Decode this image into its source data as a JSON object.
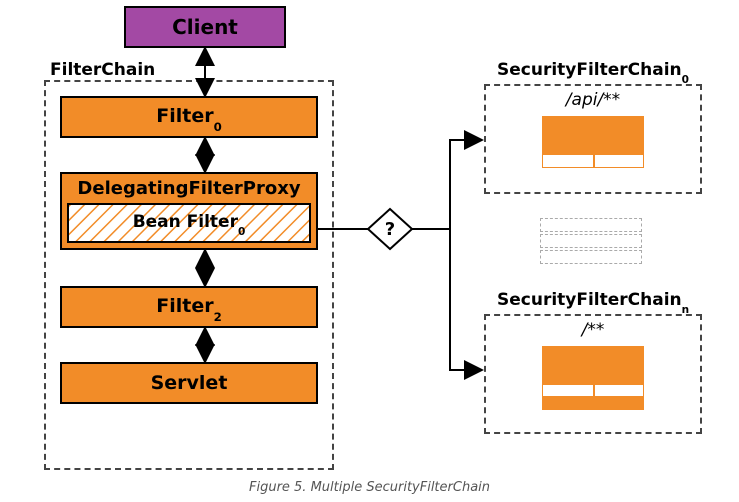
{
  "client": {
    "label": "Client"
  },
  "filterchain": {
    "label": "FilterChain"
  },
  "filter0": {
    "label": "Filter",
    "sub": "0"
  },
  "delegating": {
    "label": "DelegatingFilterProxy"
  },
  "bean": {
    "label": "Bean Filter",
    "sub": "0"
  },
  "filter2": {
    "label": "Filter",
    "sub": "2"
  },
  "servlet": {
    "label": "Servlet"
  },
  "decision": {
    "label": "?"
  },
  "sfc0": {
    "label": "SecurityFilterChain",
    "sub": "0",
    "pattern": "/api/**"
  },
  "sfcn": {
    "label": "SecurityFilterChain",
    "sub": "n",
    "pattern": "/**"
  },
  "caption": "Figure 5. Multiple SecurityFilterChain"
}
